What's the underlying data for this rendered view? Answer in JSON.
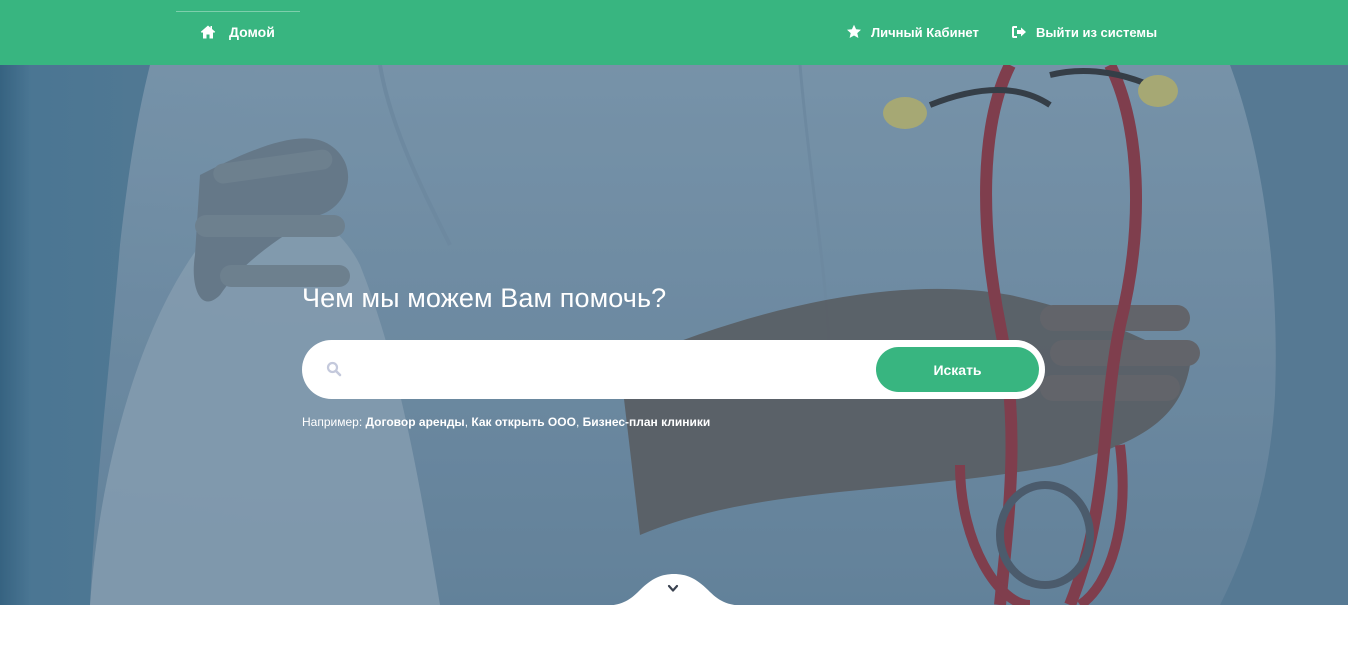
{
  "nav": {
    "home_label": "Домой",
    "home_icon": "home-icon",
    "cabinet_label": "Личный Кабинет",
    "cabinet_icon": "star-icon",
    "logout_label": "Выйти из системы",
    "logout_icon": "sign-out-icon"
  },
  "hero": {
    "title": "Чем мы можем Вам помочь?",
    "search": {
      "placeholder": "",
      "value": "",
      "icon": "search-icon",
      "button_label": "Искать"
    },
    "examples": {
      "prefix": "Например:",
      "links": [
        "Договор аренды",
        "Как открыть ООО",
        "Бизнес-план клиники"
      ]
    },
    "scroll_icon": "chevron-down-icon"
  },
  "colors": {
    "brand_green": "#38b580",
    "white": "#ffffff"
  }
}
